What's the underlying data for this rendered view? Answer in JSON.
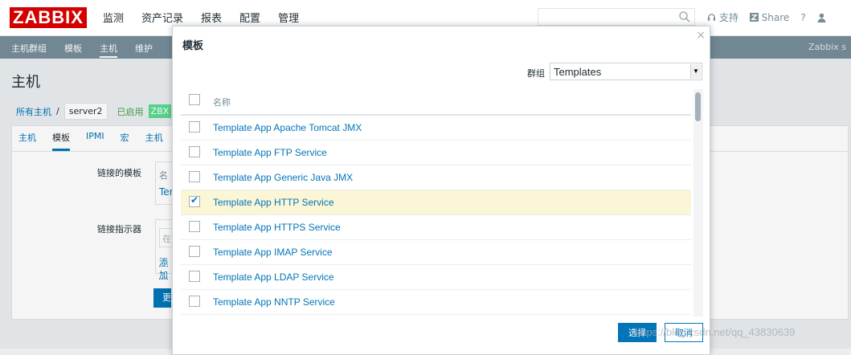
{
  "header": {
    "logo": "ZABBIX",
    "nav": [
      "监测",
      "资产记录",
      "报表",
      "配置",
      "管理"
    ],
    "links": {
      "support": "支持",
      "share": "Share",
      "help": "?"
    }
  },
  "subnav": {
    "items": [
      "主机群组",
      "模板",
      "主机",
      "维护"
    ],
    "active_index": 2,
    "right_text": "Zabbix s"
  },
  "page": {
    "title": "主机",
    "breadcrumb": {
      "all_hosts": "所有主机",
      "separator": "/",
      "host": "server2",
      "status": "已启用",
      "zbx": "ZBX"
    },
    "tabs": [
      "主机",
      "模板",
      "IPMI",
      "宏",
      "主机"
    ],
    "active_tab_index": 1,
    "form": {
      "linked_templates_label": "链接的模板",
      "linked_templates_hint": "名",
      "linked_templates_value": "Ter",
      "link_indicator_label": "链接指示器",
      "link_indicator_placeholder": "在",
      "add_link": "添加",
      "update_btn": "更"
    }
  },
  "modal": {
    "title": "模板",
    "close_glyph": "×",
    "group_label": "群组",
    "group_value": "Templates",
    "column_name": "名称",
    "rows": [
      {
        "name": "Template App Apache Tomcat JMX",
        "checked": false
      },
      {
        "name": "Template App FTP Service",
        "checked": false
      },
      {
        "name": "Template App Generic Java JMX",
        "checked": false
      },
      {
        "name": "Template App HTTP Service",
        "checked": true
      },
      {
        "name": "Template App HTTPS Service",
        "checked": false
      },
      {
        "name": "Template App IMAP Service",
        "checked": false
      },
      {
        "name": "Template App LDAP Service",
        "checked": false
      },
      {
        "name": "Template App NNTP Service",
        "checked": false
      }
    ],
    "buttons": {
      "select": "选择",
      "cancel": "取消"
    }
  },
  "watermark": "https://blog.csdn.net/qq_43830639",
  "colors": {
    "brand": "#d40000",
    "link": "#0275b8",
    "selected_row": "#fbf6d6",
    "subbar": "#768d99"
  }
}
